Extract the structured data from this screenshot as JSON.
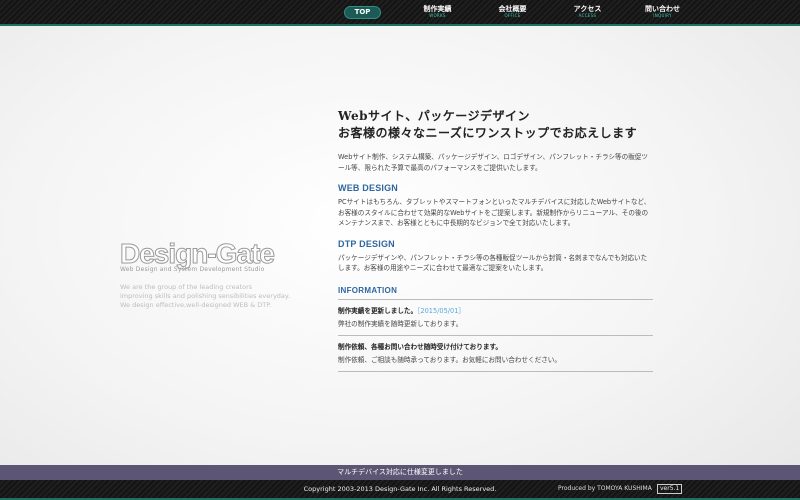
{
  "nav": {
    "top_label": "TOP",
    "items": [
      {
        "jp": "制作実績",
        "en": "WORKS"
      },
      {
        "jp": "会社概要",
        "en": "OFFICE"
      },
      {
        "jp": "アクセス",
        "en": "ACCESS"
      },
      {
        "jp": "問い合わせ",
        "en": "INQUIRY"
      }
    ]
  },
  "logo": {
    "wordmark": "Design-Gate",
    "subtitle": "Web Design and System Development Studio",
    "tagline": [
      "We are the group of the leading creators",
      "improving skills and polishing sensibilities everyday.",
      "We design effective,well-designed WEB & DTP."
    ]
  },
  "main": {
    "headline_1": "Webサイト、パッケージデザイン",
    "headline_2": "お客様の様々なニーズにワンストップでお応えします",
    "intro": "Webサイト制作、システム構築、パッケージデザイン、ロゴデザイン、パンフレット・チラシ等の販促ツール等、限られた予算で最高のパフォーマンスをご提供いたします。",
    "web_title": "WEB DESIGN",
    "web_body": "PCサイトはもちろん、タブレットやスマートフォンといったマルチデバイスに対応したWebサイトなど、お客様のスタイルに合わせて効果的なWebサイトをご提案します。新規制作からリニューアル、その後のメンテナンスまで、お客様とともに中長期的なビジョンで全て対応いたします。",
    "dtp_title": "DTP DESIGN",
    "dtp_body": "パッケージデザインや、パンフレット・チラシ等の各種販促ツールから封筒・名刺までなんでも対応いたします。お客様の用途やニーズに合わせて最適なご提案をいたします。",
    "info_title": "INFORMATION",
    "news": [
      {
        "title": "制作実績を更新しました。",
        "date": "［2015/05/01］",
        "body": "弊社の制作実績を随時更新しております。"
      },
      {
        "title": "制作依頼、各種お問い合わせ随時受け付けております。",
        "date": "",
        "body": "制作依頼、ご相談も随時承っております。お気軽にお問い合わせください。"
      }
    ]
  },
  "notice": "マルチデバイス対応に仕様変更しました",
  "footer": {
    "copyright": "Copyright 2003-2013 Design-Gate Inc. All Rights Reserved.",
    "producer": "Produced by TOMOYA KUSHIMA",
    "version": "ver5.1"
  }
}
